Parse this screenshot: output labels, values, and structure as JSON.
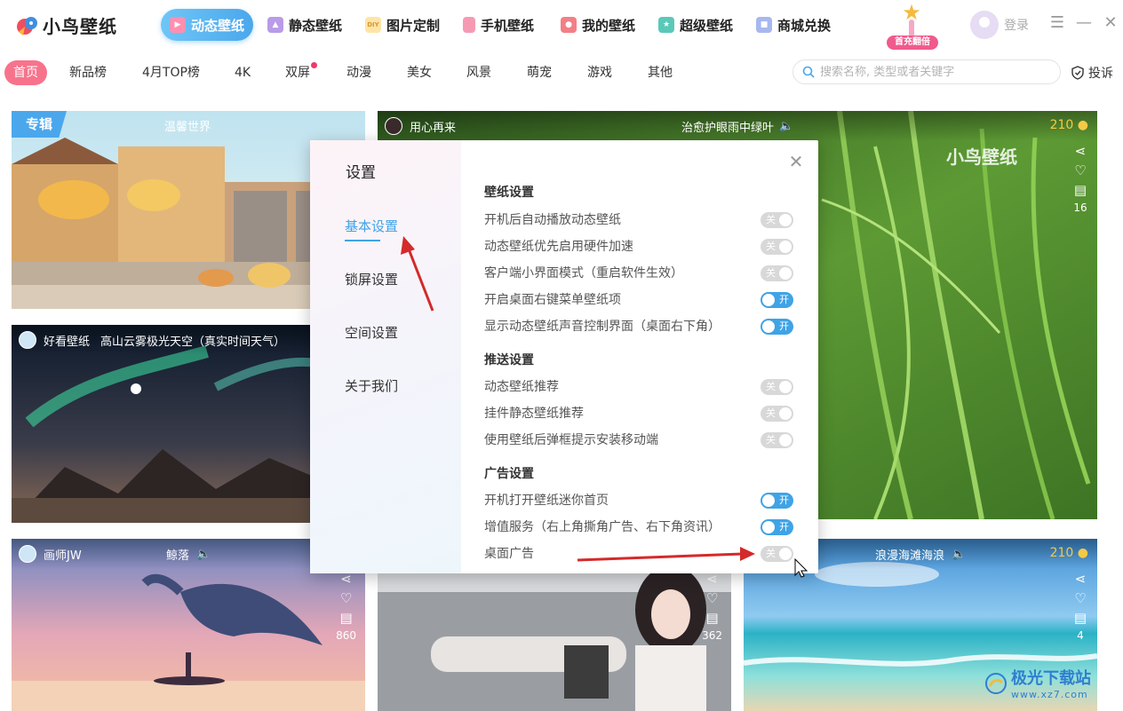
{
  "app": {
    "name": "小鸟壁纸",
    "login_label": "登录",
    "first_badge": "首充翻倍"
  },
  "nav_tabs": [
    {
      "label": "动态壁纸",
      "icon": "play-icon",
      "active": true
    },
    {
      "label": "静态壁纸",
      "icon": "image-icon",
      "active": false
    },
    {
      "label": "图片定制",
      "icon": "diy-icon",
      "active": false
    },
    {
      "label": "手机壁纸",
      "icon": "phone-icon",
      "active": false
    },
    {
      "label": "我的壁纸",
      "icon": "user-icon",
      "active": false
    },
    {
      "label": "超级壁纸",
      "icon": "star-icon",
      "active": false
    },
    {
      "label": "商城兑换",
      "icon": "bag-icon",
      "active": false
    }
  ],
  "categories": [
    {
      "label": "首页",
      "active": true
    },
    {
      "label": "新品榜"
    },
    {
      "label": "4月TOP榜"
    },
    {
      "label": "4K"
    },
    {
      "label": "双屏",
      "dot": true
    },
    {
      "label": "动漫"
    },
    {
      "label": "美女"
    },
    {
      "label": "风景"
    },
    {
      "label": "萌宠"
    },
    {
      "label": "游戏"
    },
    {
      "label": "其他"
    }
  ],
  "search": {
    "placeholder": "搜索名称, 类型或者关键字"
  },
  "report_label": "投诉",
  "cards": {
    "card1": {
      "tag": "专辑",
      "title": "温馨世界"
    },
    "card2": {
      "user": "用心再来",
      "title": "治愈护眼雨中绿叶",
      "coins": "210",
      "comments": "16",
      "watermark": "小鸟壁纸"
    },
    "card3": {
      "user": "好看壁纸",
      "title": "高山云雾极光天空（真实时间天气）"
    },
    "card4": {
      "user": "画师JW",
      "title": "鲸落",
      "comments": "860"
    },
    "card5": {
      "comments": "362"
    },
    "card6": {
      "title": "浪漫海滩海浪",
      "coins": "210",
      "comments": "4"
    }
  },
  "settings": {
    "title": "设置",
    "menu": [
      "基本设置",
      "锁屏设置",
      "空间设置",
      "关于我们"
    ],
    "sections": [
      {
        "heading": "壁纸设置",
        "rows": [
          {
            "label": "开机后自动播放动态壁纸",
            "state": "关"
          },
          {
            "label": "动态壁纸优先启用硬件加速",
            "state": "关"
          },
          {
            "label": "客户端小界面模式（重启软件生效）",
            "state": "关"
          },
          {
            "label": "开启桌面右键菜单壁纸项",
            "state": "开"
          },
          {
            "label": "显示动态壁纸声音控制界面（桌面右下角）",
            "state": "开"
          }
        ]
      },
      {
        "heading": "推送设置",
        "rows": [
          {
            "label": "动态壁纸推荐",
            "state": "关"
          },
          {
            "label": "挂件静态壁纸推荐",
            "state": "关"
          },
          {
            "label": "使用壁纸后弹框提示安装移动端",
            "state": "关"
          }
        ]
      },
      {
        "heading": "广告设置",
        "rows": [
          {
            "label": "开机打开壁纸迷你首页",
            "state": "开"
          },
          {
            "label": "增值服务（右上角撕角广告、右下角资讯）",
            "state": "开"
          },
          {
            "label": "桌面广告",
            "state": "关"
          }
        ]
      }
    ]
  },
  "site_watermark": {
    "title": "极光下载站",
    "url": "www.xz7.com"
  },
  "colors": {
    "accent": "#3fa3e6",
    "category_active": "#f7738c",
    "annotation_arrow": "#d42a2a",
    "coin": "#f6c945"
  }
}
